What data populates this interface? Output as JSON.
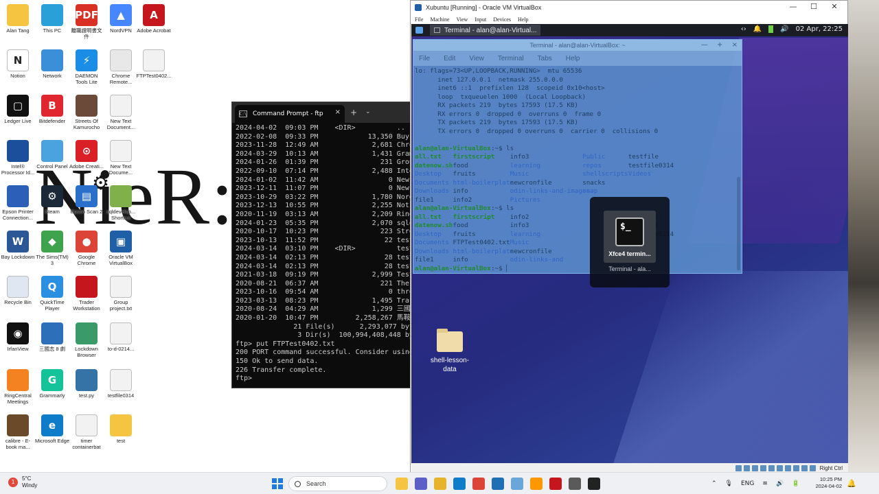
{
  "wallpaper": {
    "text": "NieR:A"
  },
  "desktop_icons": [
    {
      "label": "Alan Tang",
      "icon": "folder-icon",
      "color": "#f5c542",
      "glyph": ""
    },
    {
      "label": "This PC",
      "icon": "monitor-icon",
      "color": "#2aa0d8",
      "glyph": ""
    },
    {
      "label": "離職證明書文件",
      "icon": "pdf-icon",
      "color": "#d93025",
      "glyph": "PDF"
    },
    {
      "label": "NordVPN",
      "icon": "nordvpn-icon",
      "color": "#4687ff",
      "glyph": "▲"
    },
    {
      "label": "Adobe Acrobat",
      "icon": "acrobat-icon",
      "color": "#c4161c",
      "glyph": "A"
    },
    {
      "label": "Notion",
      "icon": "notion-icon",
      "color": "#ffffff",
      "glyph": "N"
    },
    {
      "label": "Network",
      "icon": "network-icon",
      "color": "#3b8fd8",
      "glyph": ""
    },
    {
      "label": "DAEMON Tools Lite",
      "icon": "daemon-tools-icon",
      "color": "#1a8ee6",
      "glyph": "⚡"
    },
    {
      "label": "Chrome Remote...",
      "icon": "chrome-remote-icon",
      "color": "#e8e8e8",
      "glyph": ""
    },
    {
      "label": "FTPTest0402...",
      "icon": "text-file-icon",
      "color": "#f2f2f2",
      "glyph": ""
    },
    {
      "label": "Ledger Live",
      "icon": "ledger-icon",
      "color": "#111111",
      "glyph": "▢"
    },
    {
      "label": "Bitdefender",
      "icon": "bitdefender-icon",
      "color": "#e0262e",
      "glyph": "B"
    },
    {
      "label": "Streets Of Kamurocho",
      "icon": "game-icon",
      "color": "#6b4a3a",
      "glyph": ""
    },
    {
      "label": "New Text Document...",
      "icon": "text-file-icon",
      "color": "#f2f2f2",
      "glyph": ""
    },
    {
      "label": "Intel® Processor Id...",
      "icon": "intel-icon",
      "color": "#1b4f9c",
      "glyph": ""
    },
    {
      "label": "Control Panel",
      "icon": "control-panel-icon",
      "color": "#4aa3df",
      "glyph": ""
    },
    {
      "label": "Adobe Creati...",
      "icon": "creative-cloud-icon",
      "color": "#da1f26",
      "glyph": "⊙"
    },
    {
      "label": "New Text Docume...",
      "icon": "text-file-icon",
      "color": "#f2f2f2",
      "glyph": ""
    },
    {
      "label": "Epson Printer Connection...",
      "icon": "epson-icon",
      "color": "#2c5fb8",
      "glyph": ""
    },
    {
      "label": "Steam",
      "icon": "steam-icon",
      "color": "#1b2838",
      "glyph": "⚙"
    },
    {
      "label": "Epson Scan 2",
      "icon": "scanner-icon",
      "color": "#2a6fc9",
      "glyph": "▤"
    },
    {
      "label": "sqldevelop... Shortcut",
      "icon": "sqldeveloper-icon",
      "color": "#7fb04a",
      "glyph": ""
    },
    {
      "label": "Bay Lockdown",
      "icon": "word-icon",
      "color": "#2b5797",
      "glyph": "W"
    },
    {
      "label": "The Sims(TM) 3",
      "icon": "sims-icon",
      "color": "#3fa34d",
      "glyph": "◆"
    },
    {
      "label": "Google Chrome",
      "icon": "chrome-icon",
      "color": "#db4437",
      "glyph": "●"
    },
    {
      "label": "Oracle VM VirtualBox",
      "icon": "virtualbox-icon",
      "color": "#1e5fa6",
      "glyph": "▣"
    },
    {
      "label": "Recycle Bin",
      "icon": "recycle-bin-icon",
      "color": "#dfe8f2",
      "glyph": ""
    },
    {
      "label": "QuickTime Player",
      "icon": "quicktime-icon",
      "color": "#2a8fe0",
      "glyph": "Q"
    },
    {
      "label": "Trader Workstation",
      "icon": "trader-icon",
      "color": "#c4161c",
      "glyph": ""
    },
    {
      "label": "Group project.txt",
      "icon": "text-file-icon",
      "color": "#f2f2f2",
      "glyph": ""
    },
    {
      "label": "IrfanView",
      "icon": "webcam-icon",
      "color": "#111111",
      "glyph": "◉"
    },
    {
      "label": "三國志 8 劇",
      "icon": "game-window-icon",
      "color": "#2d6fb8",
      "glyph": ""
    },
    {
      "label": "Lockdown Browser",
      "icon": "lockdown-icon",
      "color": "#3a9a6a",
      "glyph": ""
    },
    {
      "label": "to-d-0214...",
      "icon": "text-file-icon",
      "color": "#f2f2f2",
      "glyph": ""
    },
    {
      "label": "RingCentral Meetings",
      "icon": "ringcentral-icon",
      "color": "#f58220",
      "glyph": ""
    },
    {
      "label": "Grammarly",
      "icon": "grammarly-icon",
      "color": "#15c39a",
      "glyph": "G"
    },
    {
      "label": "test.py",
      "icon": "python-icon",
      "color": "#3572a5",
      "glyph": ""
    },
    {
      "label": "testfile0314",
      "icon": "text-file-icon",
      "color": "#f2f2f2",
      "glyph": ""
    },
    {
      "label": "calibre - E-book ma...",
      "icon": "calibre-icon",
      "color": "#6b4a2a",
      "glyph": ""
    },
    {
      "label": "Microsoft Edge",
      "icon": "edge-icon",
      "color": "#0f7cc9",
      "glyph": "e"
    },
    {
      "label": "timer containerbat",
      "icon": "text-file-icon",
      "color": "#f2f2f2",
      "glyph": ""
    },
    {
      "label": "test",
      "icon": "folder-icon",
      "color": "#f5c542",
      "glyph": ""
    }
  ],
  "cmd": {
    "title": "Command Prompt - ftp",
    "close": "×",
    "new_tab": "+",
    "dropdown": "⌄",
    "lines": [
      "2024-04-02  09:03 PM    <DIR>          ..",
      "2022-02-08  09:33 PM            13,350 Buy",
      "2023-11-28  12:49 AM             2,681 Chro",
      "2024-03-29  10:13 AM             1,431 Gram",
      "2024-01-26  01:39 PM               231 Grou",
      "2022-09-10  07:14 PM             2,488 Inte",
      "2024-01-02  11:42 AM                 0 New",
      "2023-12-11  11:07 PM                 0 New",
      "2023-10-29  03:22 PM             1,780 Nord",
      "2023-12-13  10:55 PM             2,255 Noti",
      "2020-11-19  03:13 AM             2,209 Ring",
      "2024-01-23  05:35 PM             2,070 sqld",
      "2020-10-17  10:23 PM               223 Stre",
      "2023-10-13  11:52 PM                22 test",
      "2024-03-14  03:10 PM    <DIR>          test",
      "2024-03-14  02:13 PM                28 test",
      "2024-03-14  02:13 PM                28 test",
      "2021-03-18  09:19 PM             2,999 Test",
      "2020-08-21  06:37 AM               221 The",
      "2023-10-16  09:54 AM                 0 thre",
      "2023-03-13  08:23 PM             1,495 Trac",
      "2020-08-24  04:29 AM             1,299 三國",
      "2020-01-20  10:47 PM         2,258,267 馬鞍",
      "              21 File(s)      2,293,077 byt",
      "               3 Dir(s)  100,994,408,448 by",
      "ftp> put FTPTest0402.txt",
      "200 PORT command successful. Consider using",
      "150 Ok to send data.",
      "226 Transfer complete.",
      "ftp>"
    ]
  },
  "vbox": {
    "title": "Xubuntu [Running] - Oracle VM VirtualBox",
    "controls": [
      "—",
      "☐",
      "✕"
    ],
    "menu": [
      "File",
      "Machine",
      "View",
      "Input",
      "Devices",
      "Help"
    ],
    "host_key": "Right Ctrl"
  },
  "xfce": {
    "task_label": "Terminal - alan@alan-Virtual...",
    "tray_arrows": "‹›",
    "datetime": "02 Apr, 22:25",
    "desktop_folder": "shell-lesson-data"
  },
  "terminal": {
    "title": "Terminal - alan@alan-VirtualBox: ~",
    "controls": [
      "—",
      "+",
      "×"
    ],
    "menu": [
      "File",
      "Edit",
      "View",
      "Terminal",
      "Tabs",
      "Help"
    ],
    "lines": [
      [
        {
          "t": "lo: flags=73<UP,LOOPBACK,RUNNING>  mtu 65536",
          "col": 0,
          "cls": "dark"
        }
      ],
      [
        {
          "t": "inet 127.0.0.1  netmask 255.0.0.0",
          "col": 6,
          "cls": "dark"
        }
      ],
      [
        {
          "t": "inet6 ::1  prefixlen 128  scopeid 0x10<host>",
          "col": 6,
          "cls": "dark"
        }
      ],
      [
        {
          "t": "loop  txqueuelen 1000  (Local Loopback)",
          "col": 6,
          "cls": "dark"
        }
      ],
      [
        {
          "t": "RX packets 219  bytes 17593 (17.5 KB)",
          "col": 6,
          "cls": "dark"
        }
      ],
      [
        {
          "t": "RX errors 0  dropped 0  overruns 0  frame 0",
          "col": 6,
          "cls": "dark"
        }
      ],
      [
        {
          "t": "TX packets 219  bytes 17593 (17.5 KB)",
          "col": 6,
          "cls": "dark"
        }
      ],
      [
        {
          "t": "TX errors 0  dropped 0 overruns 0  carrier 0  collisions 0",
          "col": 6,
          "cls": "dark"
        }
      ],
      [],
      [
        {
          "t": "alan@alan-VirtualBox",
          "col": 0,
          "cls": "green"
        },
        {
          "t": ":~$ ls",
          "col": 20,
          "cls": "dark"
        }
      ],
      [
        {
          "t": "all.txt",
          "col": 0,
          "cls": "green"
        },
        {
          "t": "firstscript",
          "col": 10,
          "cls": "green"
        },
        {
          "t": "info3",
          "col": 25,
          "cls": "dark"
        },
        {
          "t": "Public",
          "col": 44,
          "cls": "blue"
        },
        {
          "t": "testfile",
          "col": 56,
          "cls": "dark"
        }
      ],
      [
        {
          "t": "datenow.sh",
          "col": 0,
          "cls": "green"
        },
        {
          "t": "food",
          "col": 10,
          "cls": "dark"
        },
        {
          "t": "learning",
          "col": 25,
          "cls": "blue"
        },
        {
          "t": "repos",
          "col": 44,
          "cls": "blue"
        },
        {
          "t": "testfile0314",
          "col": 56,
          "cls": "dark"
        }
      ],
      [
        {
          "t": "Desktop",
          "col": 0,
          "cls": "blue"
        },
        {
          "t": "fruits",
          "col": 10,
          "cls": "dark"
        },
        {
          "t": "Music",
          "col": 25,
          "cls": "blue"
        },
        {
          "t": "shellscripts",
          "col": 44,
          "cls": "blue"
        },
        {
          "t": "Videos",
          "col": 56,
          "cls": "blue"
        }
      ],
      [
        {
          "t": "Documents",
          "col": 0,
          "cls": "blue"
        },
        {
          "t": "html-boilerplate",
          "col": 10,
          "cls": "blue"
        },
        {
          "t": "newcronfile",
          "col": 25,
          "cls": "dark"
        },
        {
          "t": "snacks",
          "col": 44,
          "cls": "dark"
        }
      ],
      [
        {
          "t": "Downloads",
          "col": 0,
          "cls": "blue"
        },
        {
          "t": "info",
          "col": 10,
          "cls": "dark"
        },
        {
          "t": "odin-links-and-images",
          "col": 25,
          "cls": "blue"
        },
        {
          "t": "snap",
          "col": 44,
          "cls": "blue"
        }
      ],
      [
        {
          "t": "file1",
          "col": 0,
          "cls": "dark"
        },
        {
          "t": "info2",
          "col": 10,
          "cls": "dark"
        },
        {
          "t": "Pictures",
          "col": 25,
          "cls": "blue"
        }
      ],
      [
        {
          "t": "alan@alan-VirtualBox",
          "col": 0,
          "cls": "green"
        },
        {
          "t": ":~$ ls",
          "col": 20,
          "cls": "dark"
        }
      ],
      [
        {
          "t": "all.txt",
          "col": 0,
          "cls": "green"
        },
        {
          "t": "firstscript",
          "col": 10,
          "cls": "green"
        },
        {
          "t": "info2",
          "col": 25,
          "cls": "dark"
        },
        {
          "t": "Templates",
          "col": 56,
          "cls": "blue"
        }
      ],
      [
        {
          "t": "datenow.sh",
          "col": 0,
          "cls": "green"
        },
        {
          "t": "food",
          "col": 10,
          "cls": "dark"
        },
        {
          "t": "info3",
          "col": 25,
          "cls": "dark"
        },
        {
          "t": "testfile",
          "col": 56,
          "cls": "dark"
        }
      ],
      [
        {
          "t": "Desktop",
          "col": 0,
          "cls": "blue"
        },
        {
          "t": "fruits",
          "col": 10,
          "cls": "dark"
        },
        {
          "t": "learning",
          "col": 25,
          "cls": "blue"
        },
        {
          "t": "testfile0314",
          "col": 56,
          "cls": "dark"
        }
      ],
      [
        {
          "t": "Documents",
          "col": 0,
          "cls": "blue"
        },
        {
          "t": "FTPTest0402.txt",
          "col": 10,
          "cls": "dark"
        },
        {
          "t": "Music",
          "col": 25,
          "cls": "blue"
        },
        {
          "t": "Videos",
          "col": 56,
          "cls": "blue"
        }
      ],
      [
        {
          "t": "Downloads",
          "col": 0,
          "cls": "blue"
        },
        {
          "t": "html-boilerplate",
          "col": 10,
          "cls": "blue"
        },
        {
          "t": "newcronfile",
          "col": 25,
          "cls": "dark"
        }
      ],
      [
        {
          "t": "file1",
          "col": 0,
          "cls": "dark"
        },
        {
          "t": "info",
          "col": 10,
          "cls": "dark"
        },
        {
          "t": "odin-links-and",
          "col": 25,
          "cls": "blue"
        }
      ],
      [
        {
          "t": "alan@alan-VirtualBox",
          "col": 0,
          "cls": "green"
        },
        {
          "t": ":~$ ▏",
          "col": 20,
          "cls": "dark"
        }
      ]
    ]
  },
  "switcher": {
    "glyph": "$_",
    "name": "Xfce4 termin...",
    "subtitle": "Terminal - ala..."
  },
  "taskbar": {
    "temp": "5°C",
    "condition": "Windy",
    "weather_badge": "1",
    "search_placeholder": "Search",
    "apps": [
      {
        "icon": "file-explorer-icon",
        "color": "#f5c542"
      },
      {
        "icon": "teams-icon",
        "color": "#5b5fc7"
      },
      {
        "icon": "explorer-folder-icon",
        "color": "#e8b32c"
      },
      {
        "icon": "edge-taskbar-icon",
        "color": "#0f7cc9"
      },
      {
        "icon": "chrome-taskbar-icon",
        "color": "#db4437"
      },
      {
        "icon": "mail-icon",
        "color": "#1f6fb5"
      },
      {
        "icon": "photos-icon",
        "color": "#6aa7d8"
      },
      {
        "icon": "sublime-icon",
        "color": "#ff9800"
      },
      {
        "icon": "acrobat-taskbar-icon",
        "color": "#c4161c"
      },
      {
        "icon": "cursor-app-icon",
        "color": "#5a5a5a"
      },
      {
        "icon": "terminal-taskbar-icon",
        "color": "#222222"
      }
    ],
    "tray": [
      "⌃",
      "🎙",
      "ENG",
      "≋",
      "🔊",
      "🔋"
    ],
    "time": "10:25 PM",
    "date": "2024-04-02",
    "bell": "🔔"
  }
}
